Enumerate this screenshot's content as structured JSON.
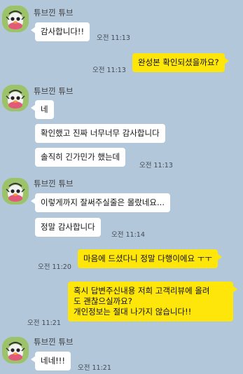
{
  "colors": {
    "background": "#b2c7da",
    "incoming_bubble": "#ffffff",
    "outgoing_bubble": "#fee50a"
  },
  "sender_name": "튜브낀 튜브",
  "messages": [
    {
      "text": "감사합니다!!",
      "time": "오전 11:13"
    },
    {
      "text": "완성본 확인되셨을까요?",
      "time": "오전 11:13"
    },
    {
      "text": "네"
    },
    {
      "text": "확인했고 진짜 너무너무 감사합니다"
    },
    {
      "text": "솔직히 긴가민가 했는데",
      "time": "오전 11:13"
    },
    {
      "text": "이렇게까지 잘써주실줄은 몰랐네요..."
    },
    {
      "text": "정말 감사합니다",
      "time": "오전 11:14"
    },
    {
      "text": "마음에 드셨다니 정말 다행이에요 ㅜㅜ",
      "time": "오전 11:20"
    },
    {
      "lines": [
        "혹시 답변주신내용 저희 고객리뷰에 올려",
        "도 괜찮으실까요?",
        "개인정보는 절대 나가지 않습니다!!"
      ],
      "time": "오전 11:21"
    },
    {
      "text": "네네!!!",
      "time": "오전 11:21"
    }
  ]
}
